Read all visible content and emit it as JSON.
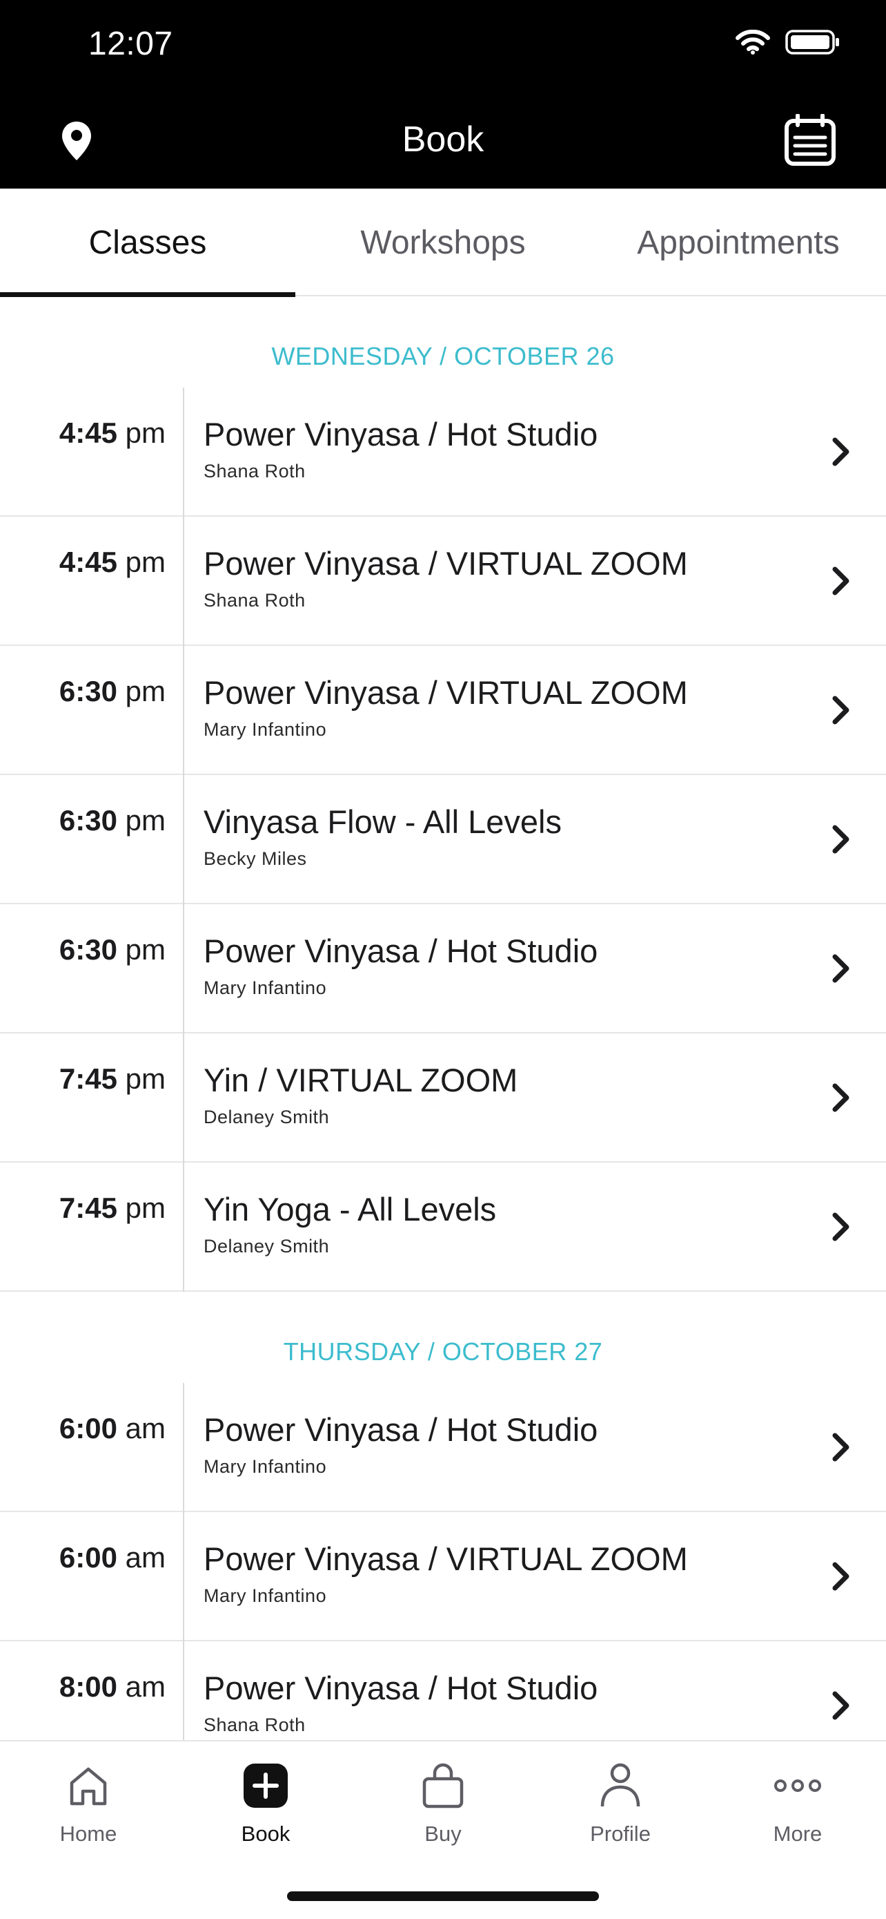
{
  "status_bar": {
    "time": "12:07"
  },
  "header": {
    "title": "Book",
    "left_icon": "location-pin-icon",
    "right_icon": "calendar-icon"
  },
  "tabs": [
    {
      "label": "Classes",
      "active": true
    },
    {
      "label": "Workshops",
      "active": false
    },
    {
      "label": "Appointments",
      "active": false
    }
  ],
  "days": [
    {
      "header": "WEDNESDAY / OCTOBER 26",
      "classes": [
        {
          "time": "4:45",
          "period": "pm",
          "name": "Power Vinyasa / Hot Studio",
          "instructor": "Shana Roth"
        },
        {
          "time": "4:45",
          "period": "pm",
          "name": "Power Vinyasa / VIRTUAL ZOOM",
          "instructor": "Shana Roth"
        },
        {
          "time": "6:30",
          "period": "pm",
          "name": "Power Vinyasa / VIRTUAL ZOOM",
          "instructor": "Mary Infantino"
        },
        {
          "time": "6:30",
          "period": "pm",
          "name": "Vinyasa Flow - All Levels",
          "instructor": "Becky Miles"
        },
        {
          "time": "6:30",
          "period": "pm",
          "name": "Power Vinyasa / Hot Studio",
          "instructor": "Mary Infantino"
        },
        {
          "time": "7:45",
          "period": "pm",
          "name": "Yin / VIRTUAL ZOOM",
          "instructor": "Delaney Smith"
        },
        {
          "time": "7:45",
          "period": "pm",
          "name": "Yin Yoga - All Levels",
          "instructor": "Delaney Smith"
        }
      ]
    },
    {
      "header": "THURSDAY / OCTOBER 27",
      "classes": [
        {
          "time": "6:00",
          "period": "am",
          "name": "Power Vinyasa / Hot Studio",
          "instructor": "Mary Infantino"
        },
        {
          "time": "6:00",
          "period": "am",
          "name": "Power Vinyasa / VIRTUAL ZOOM",
          "instructor": "Mary Infantino"
        },
        {
          "time": "8:00",
          "period": "am",
          "name": "Power Vinyasa / Hot Studio",
          "instructor": "Shana Roth"
        }
      ]
    }
  ],
  "bottom_nav": [
    {
      "label": "Home",
      "icon": "home-icon",
      "active": false
    },
    {
      "label": "Book",
      "icon": "plus-square-icon",
      "active": true
    },
    {
      "label": "Buy",
      "icon": "shopping-bag-icon",
      "active": false
    },
    {
      "label": "Profile",
      "icon": "person-icon",
      "active": false
    },
    {
      "label": "More",
      "icon": "ellipsis-icon",
      "active": false
    }
  ],
  "colors": {
    "accent": "#3cbccd",
    "header_bg": "#000000",
    "text": "#1c1c1e"
  }
}
